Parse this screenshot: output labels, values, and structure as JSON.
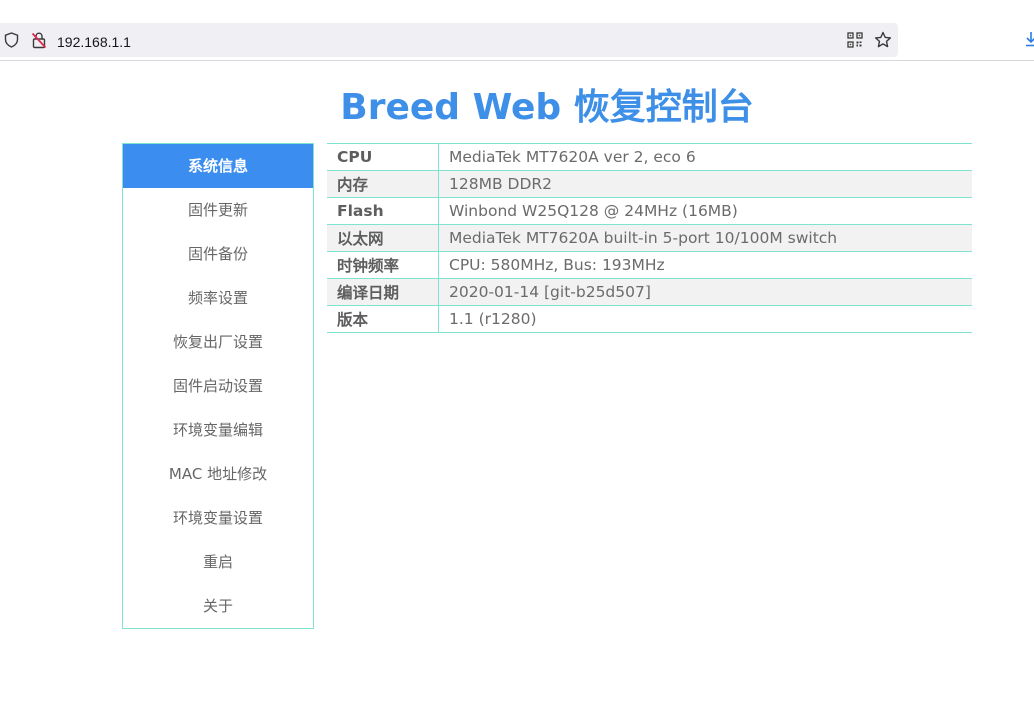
{
  "browser": {
    "url": "192.168.1.1",
    "icons": [
      "shield-icon",
      "insecure-lock-icon",
      "qr-code-icon",
      "bookmark-star-icon",
      "download-icon"
    ]
  },
  "page": {
    "title": "Breed Web 恢复控制台"
  },
  "sidebar": {
    "items": [
      {
        "label": "系统信息",
        "active": true
      },
      {
        "label": "固件更新"
      },
      {
        "label": "固件备份"
      },
      {
        "label": "频率设置"
      },
      {
        "label": "恢复出厂设置"
      },
      {
        "label": "固件启动设置"
      },
      {
        "label": "环境变量编辑"
      },
      {
        "label": "MAC 地址修改"
      },
      {
        "label": "环境变量设置"
      },
      {
        "label": "重启"
      },
      {
        "label": "关于"
      }
    ],
    "border_color": "#7fe3cf",
    "active_color": "#3b8df0"
  },
  "info": {
    "rows": [
      {
        "key": "CPU",
        "value": "MediaTek MT7620A ver 2, eco 6"
      },
      {
        "key": "内存",
        "value": "128MB DDR2"
      },
      {
        "key": "Flash",
        "value": "Winbond W25Q128 @ 24MHz (16MB)"
      },
      {
        "key": "以太网",
        "value": "MediaTek MT7620A built-in 5-port 10/100M switch"
      },
      {
        "key": "时钟频率",
        "value": "CPU: 580MHz, Bus: 193MHz"
      },
      {
        "key": "编译日期",
        "value": "2020-01-14 [git-b25d507]"
      },
      {
        "key": "版本",
        "value": "1.1 (r1280)"
      }
    ]
  },
  "colors": {
    "title": "#3d8fe8",
    "accent": "#3b8df0",
    "border": "#7fe3cf"
  }
}
